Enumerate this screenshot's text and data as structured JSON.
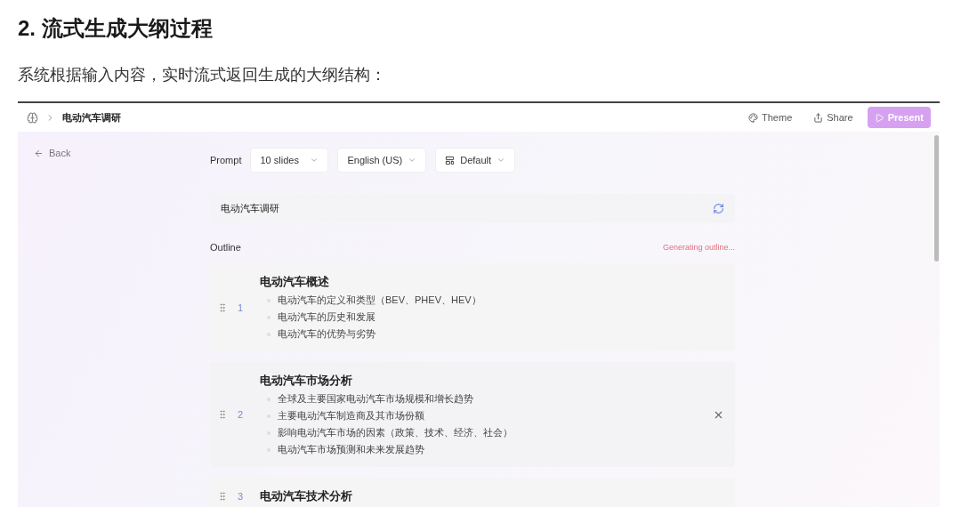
{
  "article": {
    "heading": "2. 流式生成大纲过程",
    "paragraph": "系统根据输入内容，实时流式返回生成的大纲结构："
  },
  "app": {
    "breadcrumb": "电动汽车调研",
    "actions": [
      {
        "kind": "theme",
        "label": "Theme"
      },
      {
        "kind": "share",
        "label": "Share"
      },
      {
        "kind": "present",
        "label": "Present"
      }
    ],
    "back": "Back",
    "prompt_label": "Prompt",
    "selects": [
      {
        "kind": "count",
        "value": "10 slides"
      },
      {
        "kind": "language",
        "value": "English (US)"
      },
      {
        "kind": "layout",
        "value": "Default"
      }
    ],
    "prompt_value": "电动汽车调研",
    "outline_label": "Outline",
    "status": "Generating outline...",
    "cards": [
      {
        "number": "1",
        "title": "电动汽车概述",
        "hovered": false,
        "points": [
          "电动汽车的定义和类型（BEV、PHEV、HEV）",
          "电动汽车的历史和发展",
          "电动汽车的优势与劣势"
        ]
      },
      {
        "number": "2",
        "title": "电动汽车市场分析",
        "hovered": true,
        "points": [
          "全球及主要国家电动汽车市场规模和增长趋势",
          "主要电动汽车制造商及其市场份额",
          "影响电动汽车市场的因素（政策、技术、经济、社会）",
          "电动汽车市场预测和未来发展趋势"
        ]
      },
      {
        "number": "3",
        "title": "电动汽车技术分析",
        "hovered": false
      }
    ]
  }
}
